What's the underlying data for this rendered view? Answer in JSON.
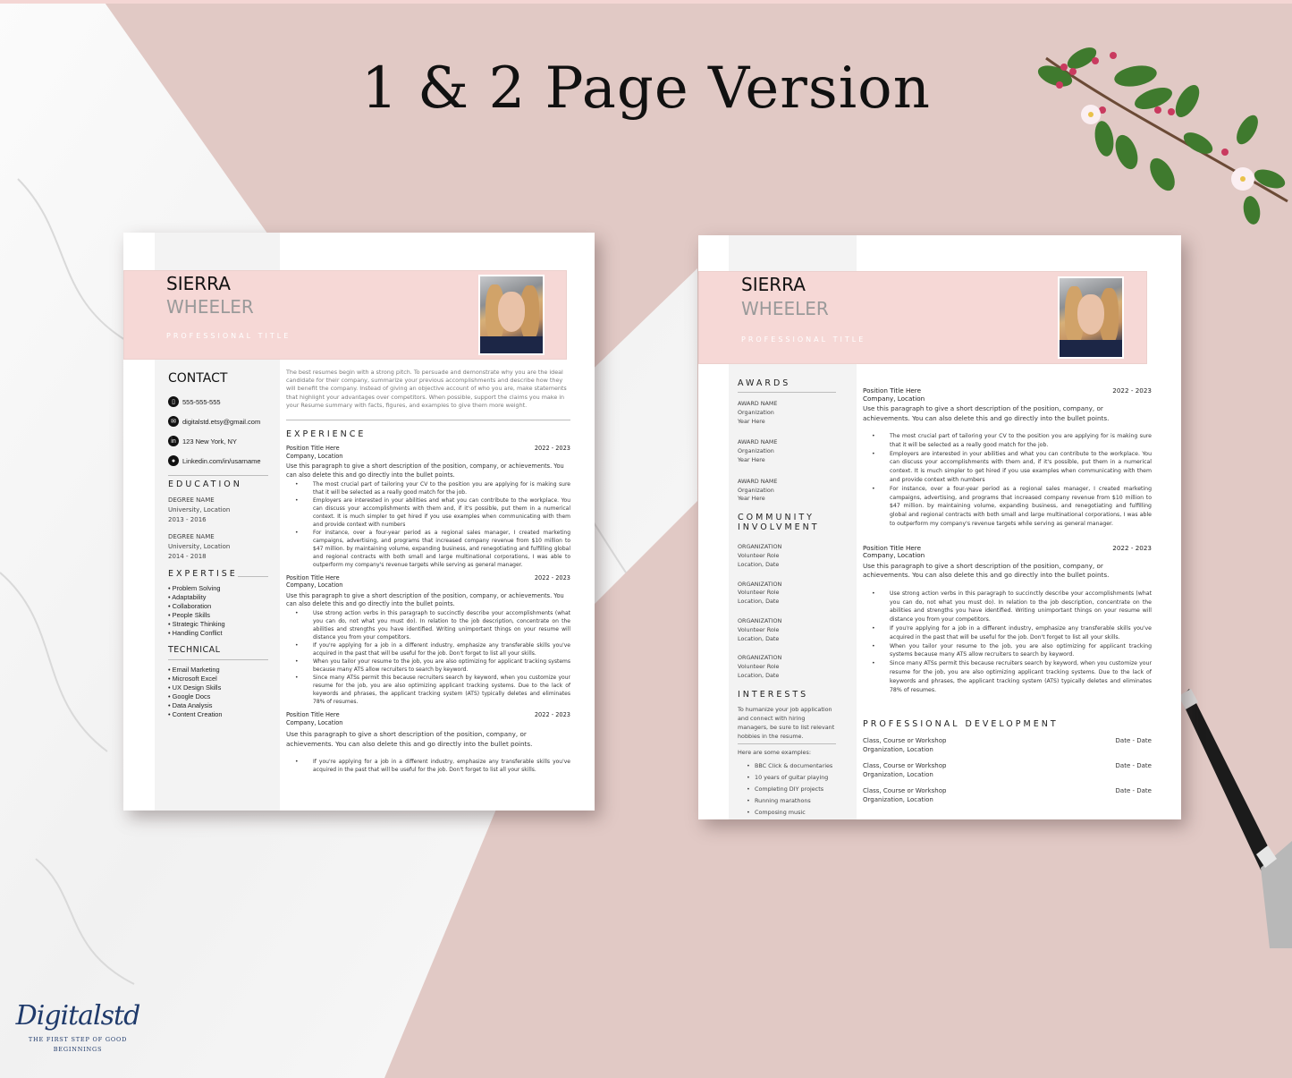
{
  "headline": "1 & 2 Page Version",
  "colors": {
    "pink": "#f6d8d6",
    "background": "#e1c9c5",
    "sidebar": "#f3f3f3",
    "logo": "#1f3a6b"
  },
  "logo": {
    "script": "Digitalstd",
    "tagline_1": "THE FIRST STEP OF GOOD",
    "tagline_2": "BEGINNINGS"
  },
  "page1": {
    "first_name": "SIERRA",
    "last_name": "WHEELER",
    "professional_title": "PROFESSIONAL TITLE",
    "contact_heading": "CONTACT",
    "contacts": [
      {
        "icon": "phone-icon",
        "glyph": "▯",
        "text": "555-555-555"
      },
      {
        "icon": "email-icon",
        "glyph": "✉",
        "text": "digitalstd.etsy@gmail.com"
      },
      {
        "icon": "linkedin-icon",
        "glyph": "in",
        "text": "123 New York, NY"
      },
      {
        "icon": "location-pin-icon",
        "glyph": "●",
        "text": "Linkedin.com/in/usarname"
      }
    ],
    "education_heading": "EDUCATION",
    "education": [
      {
        "degree": "DEGREE NAME",
        "school": "University, Location",
        "years": "2013 - 2016"
      },
      {
        "degree": "DEGREE NAME",
        "school": "University, Location",
        "years": "2014 - 2018"
      }
    ],
    "expertise_heading": "EXPERTISE",
    "expertise": [
      "Problem Solving",
      "Adaptability",
      "Collaboration",
      "People Skills",
      "Strategic Thinking",
      "Handling Conflict"
    ],
    "technical_heading": "TECHNICAL",
    "technical": [
      "Email Marketing",
      "Microsoft Excel",
      "UX Design Skills",
      "Google Docs",
      "Data Analysis",
      "Content Creation"
    ],
    "summary": "The best resumes begin with a strong pitch. To persuade and demonstrate why you are the ideal candidate for their company, summarize your previous accomplishments and describe how they will benefit the company. Instead of giving an objective account of who you are, make statements that highlight your advantages over competitors. When possible, support the claims you make in your Resume summary with facts, figures, and examples to give them more weight.",
    "experience_heading": "EXPERIENCE",
    "jobs": [
      {
        "title": "Position Title Here",
        "company": "Company, Location",
        "dates": "2022 - 2023",
        "desc": "Use this paragraph to give a short description of the position, company, or achievements. You can also delete this and go directly into the bullet points.",
        "bullets": [
          "The most crucial part of tailoring your CV to the position you are applying for is making sure that it will be selected as a really good match for the job.",
          "Employers are interested in your abilities and what you can contribute to the workplace. You can discuss your accomplishments with them and, if it's possible, put them in a numerical context. It is much simpler to get hired if you use examples when communicating with them and provide context with numbers",
          "For instance, over a four-year period as a regional sales manager, I created marketing campaigns, advertising, and programs that increased company revenue from $10 million to $47 million. by maintaining volume, expanding business, and renegotiating and fulfilling global and regional contracts with both small and large multinational corporations, I was able to outperform my company's revenue targets while serving as general manager."
        ]
      },
      {
        "title": "Position Title Here",
        "company": "Company, Location",
        "dates": "2022 - 2023",
        "desc": "Use this paragraph to give a short description of the position, company, or achievements. You can also delete this and go directly into the bullet points.",
        "bullets": [
          "Use strong action verbs in this paragraph to succinctly describe your accomplishments (what you can do, not what you must do). In relation to the job description, concentrate on the abilities and strengths you have identified. Writing unimportant things on your resume will distance you from your competitors.",
          "If you're applying for a job in a different industry, emphasize any transferable skills you've acquired in the past that will be useful for the job. Don't forget to list all your skills.",
          "When you tailor your resume to the job, you are also optimizing for applicant tracking systems because many ATS allow recruiters to search by keyword.",
          "Since many ATSs permit this because recruiters search by keyword, when you customize your resume for the job, you are also optimizing applicant tracking systems. Due to the lack of keywords and phrases, the applicant tracking system (ATS) typically deletes and eliminates 78% of resumes."
        ]
      },
      {
        "title": "Position Title Here",
        "company": "Company, Location",
        "dates": "2022 - 2023",
        "desc": "Use this paragraph to give a short description of the position, company, or achievements. You can also delete this and go directly into the bullet points.",
        "bullets": [
          "If you're applying for a job in a different industry, emphasize any transferable skills you've acquired in the past that will be useful for the job. Don't forget to list all your skills."
        ]
      }
    ]
  },
  "page2": {
    "first_name": "SIERRA",
    "last_name": "WHEELER",
    "professional_title": "PROFESSIONAL TITLE",
    "awards_heading": "AWARDS",
    "awards": [
      {
        "name": "AWARD NAME",
        "org": "Organization",
        "year": "Year Here"
      },
      {
        "name": "AWARD NAME",
        "org": "Organization",
        "year": "Year Here"
      },
      {
        "name": "AWARD NAME",
        "org": "Organization",
        "year": "Year Here"
      }
    ],
    "community_heading_1": "COMMUNITY",
    "community_heading_2": "INVOLVMENT",
    "community": [
      {
        "org": "ORGANIZATION",
        "role": "Volunteer Role",
        "where": "Location, Date"
      },
      {
        "org": "ORGANIZATION",
        "role": "Volunteer Role",
        "where": "Location, Date"
      },
      {
        "org": "ORGANIZATION",
        "role": "Volunteer Role",
        "where": "Location, Date"
      },
      {
        "org": "ORGANIZATION",
        "role": "Volunteer Role",
        "where": "Location, Date"
      }
    ],
    "interests_heading": "INTERESTS",
    "interests_intro": "To humanize your job application and connect with hiring managers, be sure to list relevant hobbies in the resume.",
    "interests_examples_label": "Here are some examples:",
    "interests": [
      "BBC Click & documentaries",
      "10 years of guitar playing",
      "Completing DIY projects",
      "Running marathons",
      "Composing music"
    ],
    "jobs": [
      {
        "title": "Position Title Here",
        "company": "Company, Location",
        "dates": "2022 - 2023",
        "desc": "Use this paragraph to give a short description of the position, company, or achievements. You can also delete this and go directly into the bullet points.",
        "bullets": [
          "The most crucial part of tailoring your CV to the position you are applying for is making sure that it will be selected as a really good match for the job.",
          "Employers are interested in your abilities and what you can contribute to the workplace. You can discuss your accomplishments with them and, if it's possible, put them in a numerical context. It is much simpler to get hired if you use examples when communicating with them and provide context with numbers",
          "For instance, over a four-year period as a regional sales manager, I created marketing campaigns, advertising, and programs that increased company revenue from $10 million to $47 million. by maintaining volume, expanding business, and renegotiating and fulfilling global and regional contracts with both small and large multinational corporations, I was able to outperform my company's revenue targets while serving as general manager."
        ]
      },
      {
        "title": "Position Title Here",
        "company": "Company, Location",
        "dates": "2022 - 2023",
        "desc": "Use this paragraph to give a short description of the position, company, or achievements. You can also delete this and go directly into the bullet points.",
        "bullets": [
          "Use strong action verbs in this paragraph to succinctly describe your accomplishments (what you can do, not what you must do). In relation to the job description, concentrate on the abilities and strengths you have identified. Writing unimportant things on your resume will distance you from your competitors.",
          "If you're applying for a job in a different industry, emphasize any transferable skills you've acquired in the past that will be useful for the job. Don't forget to list all your skills.",
          "When you tailor your resume to the job, you are also optimizing for applicant tracking systems because many ATS allow recruiters to search by keyword.",
          "Since many ATSs permit this because recruiters search by keyword, when you customize your resume for the job, you are also optimizing applicant tracking systems. Due to the lack of keywords and phrases, the applicant tracking system (ATS) typically deletes and eliminates 78% of resumes."
        ]
      }
    ],
    "prof_dev_heading": "PROFESSIONAL DEVELOPMENT",
    "prof_dev": [
      {
        "course": "Class, Course or Workshop",
        "org": "Organization, Location",
        "dates": "Date - Date"
      },
      {
        "course": "Class, Course or Workshop",
        "org": "Organization, Location",
        "dates": "Date - Date"
      },
      {
        "course": "Class, Course or Workshop",
        "org": "Organization, Location",
        "dates": "Date - Date"
      }
    ]
  }
}
